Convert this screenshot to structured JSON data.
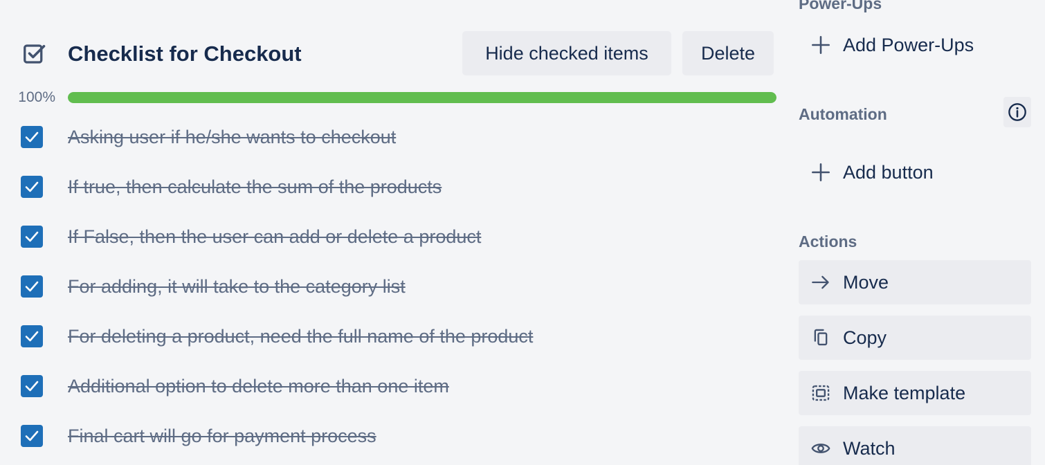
{
  "checklist": {
    "title": "Checklist for Checkout",
    "hide_checked_label": "Hide checked items",
    "delete_label": "Delete",
    "progress_text": "100%",
    "progress_fraction": 1.0,
    "items": [
      {
        "text": "Asking user if he/she wants to checkout",
        "checked": true
      },
      {
        "text": "If true, then calculate the sum of the products",
        "checked": true
      },
      {
        "text": "If False, then the user can add or delete a product",
        "checked": true
      },
      {
        "text": "For adding, it will take to the category list",
        "checked": true
      },
      {
        "text": "For deleting a product, need the full name of the product",
        "checked": true
      },
      {
        "text": "Additional option to delete more than one item",
        "checked": true
      },
      {
        "text": "Final cart will go for payment process",
        "checked": true
      }
    ]
  },
  "sidebar": {
    "powerups": {
      "heading": "Power-Ups",
      "add_label": "Add Power-Ups"
    },
    "automation": {
      "heading": "Automation",
      "add_button_label": "Add button"
    },
    "actions": {
      "heading": "Actions",
      "move_label": "Move",
      "copy_label": "Copy",
      "template_label": "Make template",
      "watch_label": "Watch"
    }
  },
  "colors": {
    "progress_complete": "#61bd4f",
    "checkbox": "#1e6fb8",
    "text_primary": "#172b4d",
    "text_muted": "#5e6c84",
    "button_bg": "#ebecf0"
  }
}
